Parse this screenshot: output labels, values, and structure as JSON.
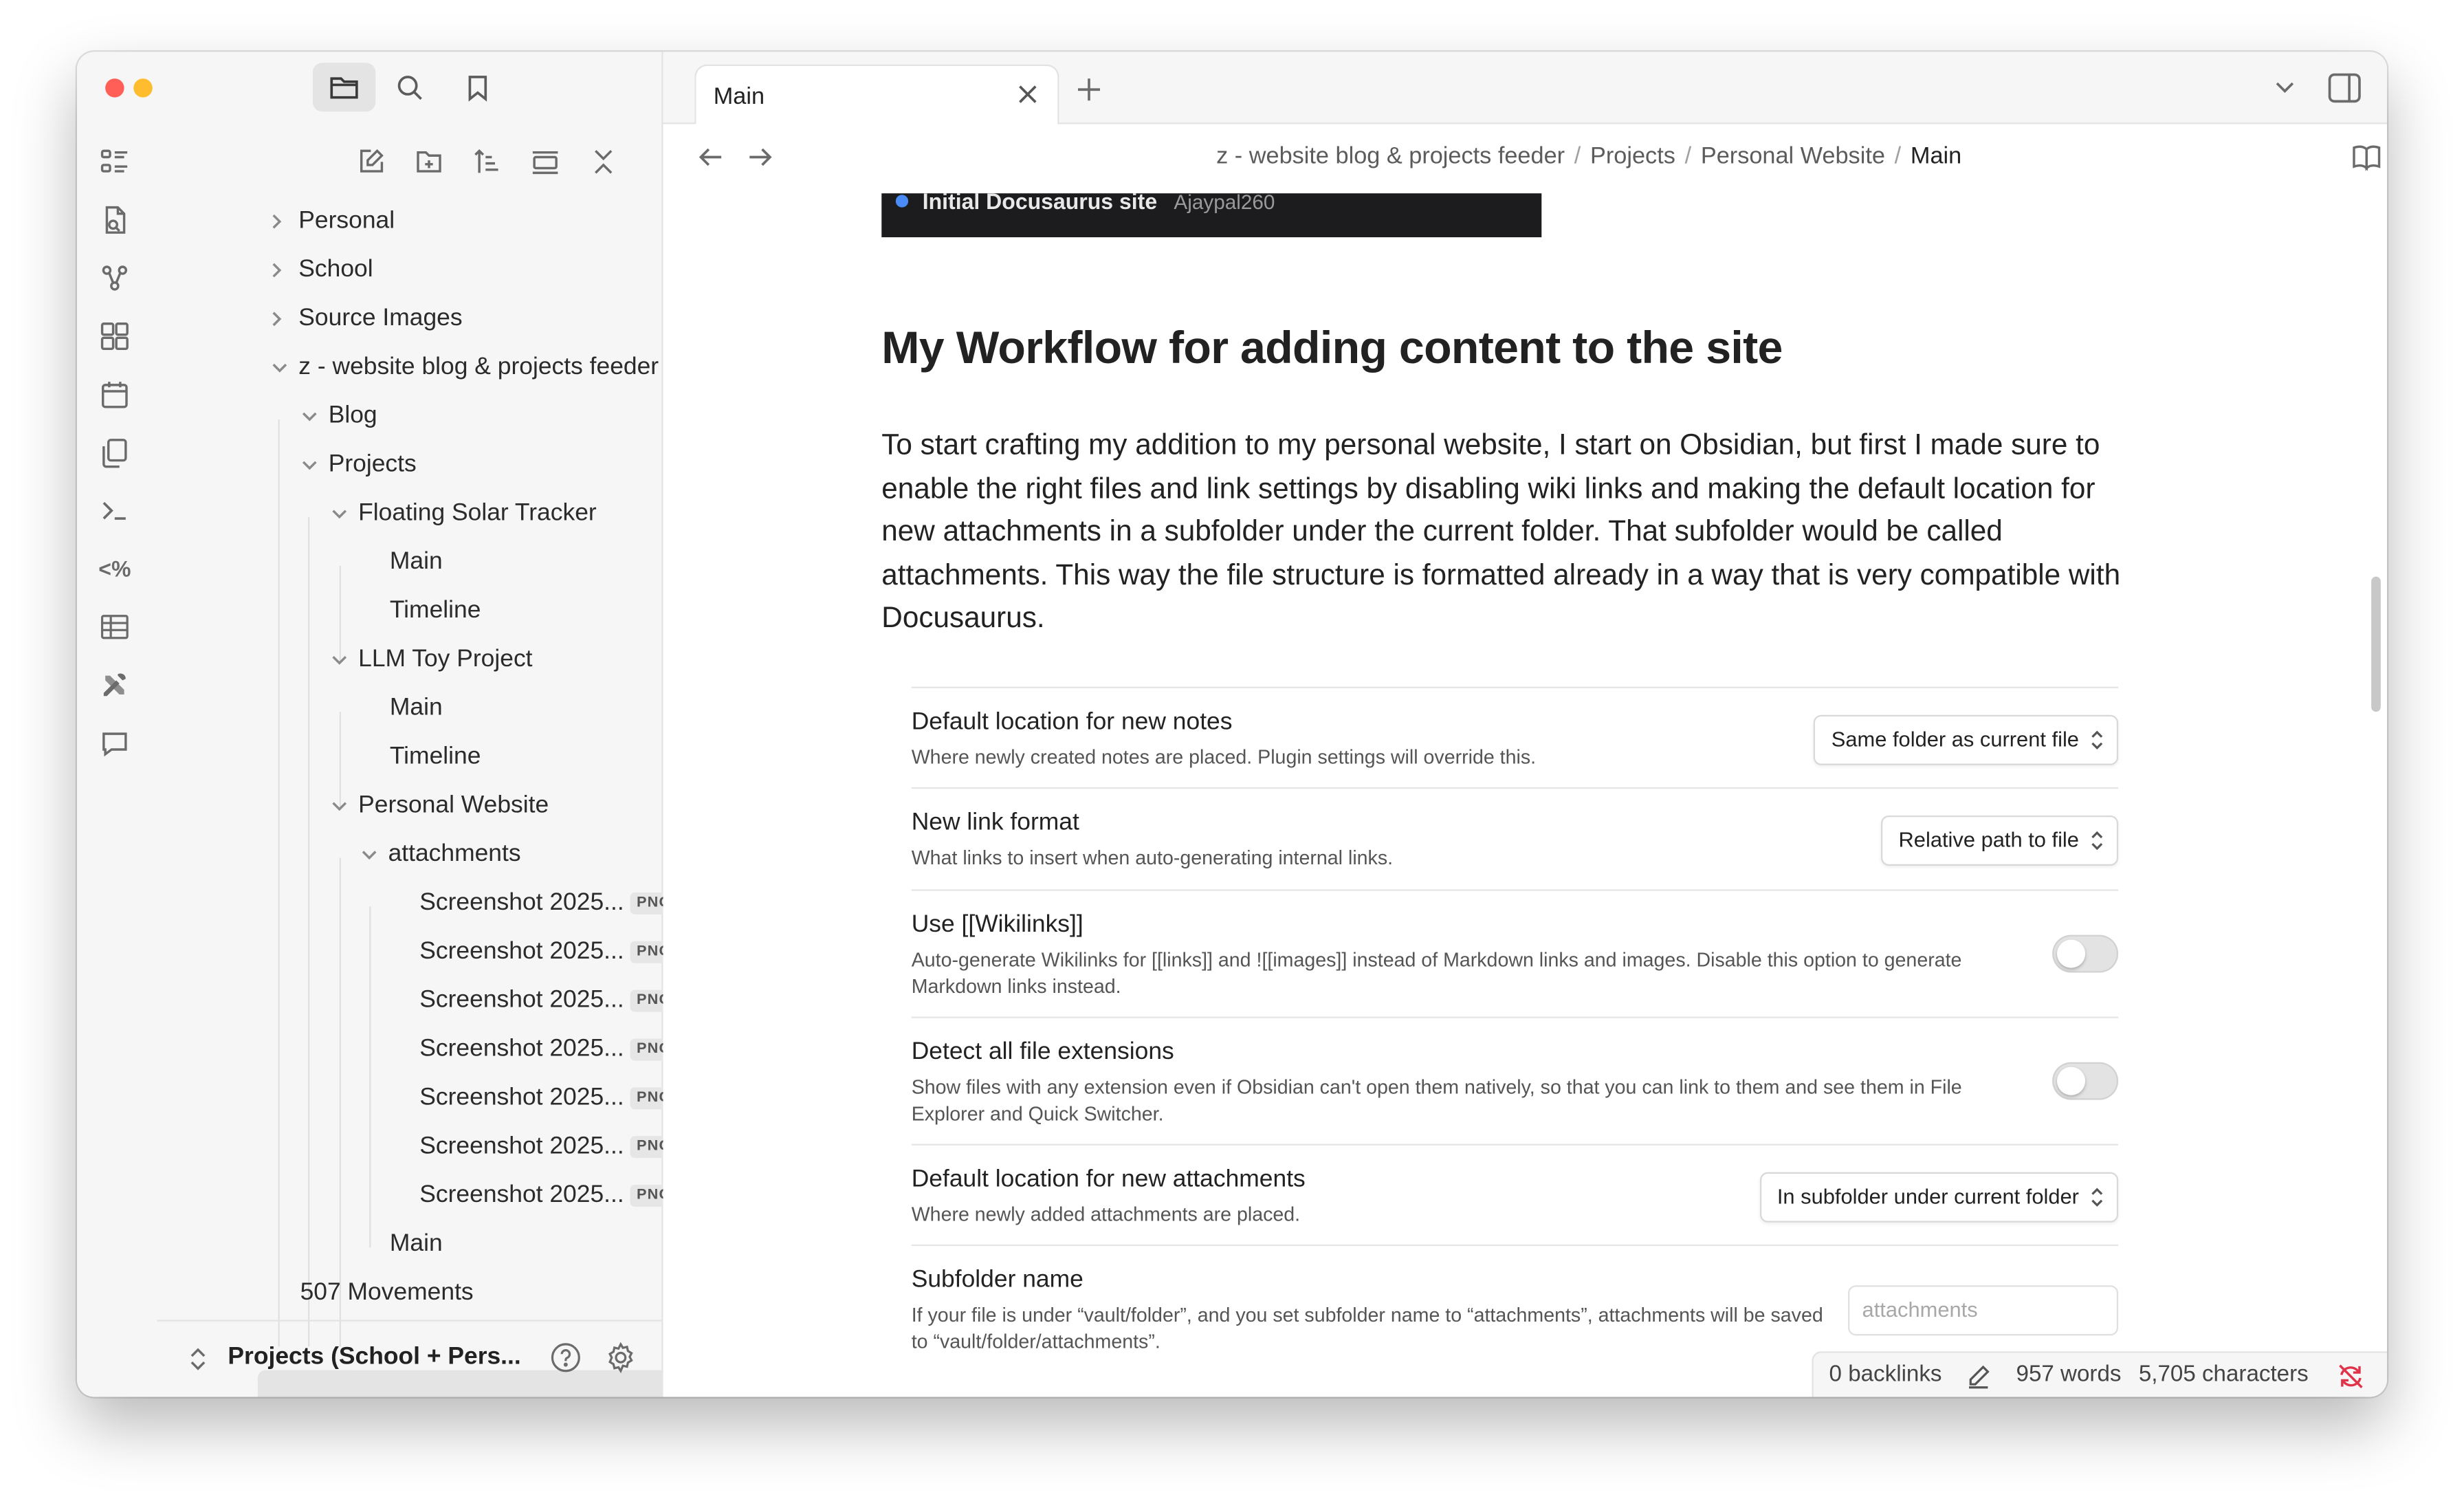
{
  "colors": {
    "close": "#ff5f57",
    "minimize": "#febc2e",
    "zoom": "#28c840",
    "sync_error": "#e0334a"
  },
  "sidebar": {
    "top_icons": [
      "folder-icon",
      "search-icon",
      "bookmark-icon"
    ],
    "actions": [
      "new-note-icon",
      "new-folder-icon",
      "sort-icon",
      "collapse-icon",
      "close-all-icon"
    ],
    "tree": [
      {
        "label": "Personal"
      },
      {
        "label": "School"
      },
      {
        "label": "Source Images"
      },
      {
        "label": "z - website blog & projects feeder"
      },
      {
        "label": "Blog"
      },
      {
        "label": "Projects"
      },
      {
        "label": "Floating Solar Tracker"
      },
      {
        "label": "Main"
      },
      {
        "label": "Timeline"
      },
      {
        "label": "LLM Toy Project"
      },
      {
        "label": "Main"
      },
      {
        "label": "Timeline"
      },
      {
        "label": "Personal Website"
      },
      {
        "label": "attachments"
      },
      {
        "label": "Screenshot 2025...",
        "badge": "PNG"
      },
      {
        "label": "Screenshot 2025...",
        "badge": "PNG"
      },
      {
        "label": "Screenshot 2025...",
        "badge": "PNG"
      },
      {
        "label": "Screenshot 2025...",
        "badge": "PNG"
      },
      {
        "label": "Screenshot 2025...",
        "badge": "PNG"
      },
      {
        "label": "Screenshot 2025...",
        "badge": "PNG"
      },
      {
        "label": "Screenshot 2025...",
        "badge": "PNG"
      },
      {
        "label": "Main"
      },
      {
        "label": "507 Movements"
      }
    ],
    "vault_name": "Projects (School + Pers..."
  },
  "tabs": [
    {
      "label": "Main"
    }
  ],
  "breadcrumb": [
    "z - website blog & projects feeder",
    "Projects",
    "Personal Website",
    "Main"
  ],
  "content": {
    "image_caption": "Initial Docusaurus site",
    "image_author": "Ajaypal260",
    "heading": "My Workflow for adding content to the site",
    "paragraph": "To start crafting my addition to my personal website, I start on Obsidian, but first I made sure to enable the right files and link settings by disabling wiki links and making the default location for new attachments in a subfolder under the current folder. That subfolder would be called attachments. This way the file structure is formatted already in a way that is very compatible with Docusaurus."
  },
  "settings": [
    {
      "name": "Default location for new notes",
      "desc": "Where newly created notes are placed. Plugin settings will override this.",
      "control": "dropdown",
      "value": "Same folder as current file"
    },
    {
      "name": "New link format",
      "desc": "What links to insert when auto-generating internal links.",
      "control": "dropdown",
      "value": "Relative path to file"
    },
    {
      "name": "Use [[Wikilinks]]",
      "desc": "Auto-generate Wikilinks for [[links]] and ![[images]] instead of Markdown links and images. Disable this option to generate Markdown links instead.",
      "control": "toggle",
      "value": "off"
    },
    {
      "name": "Detect all file extensions",
      "desc": "Show files with any extension even if Obsidian can't open them natively, so that you can link to them and see them in File Explorer and Quick Switcher.",
      "control": "toggle",
      "value": "off"
    },
    {
      "name": "Default location for new attachments",
      "desc": "Where newly added attachments are placed.",
      "control": "dropdown",
      "value": "In subfolder under current folder"
    },
    {
      "name": "Subfolder name",
      "desc": "If your file is under “vault/folder”, and you set subfolder name to “attachments”, attachments will be saved to “vault/folder/attachments”.",
      "control": "input",
      "placeholder": "attachments"
    }
  ],
  "status": {
    "backlinks": "0 backlinks",
    "words": "957 words",
    "characters": "5,705 characters"
  }
}
